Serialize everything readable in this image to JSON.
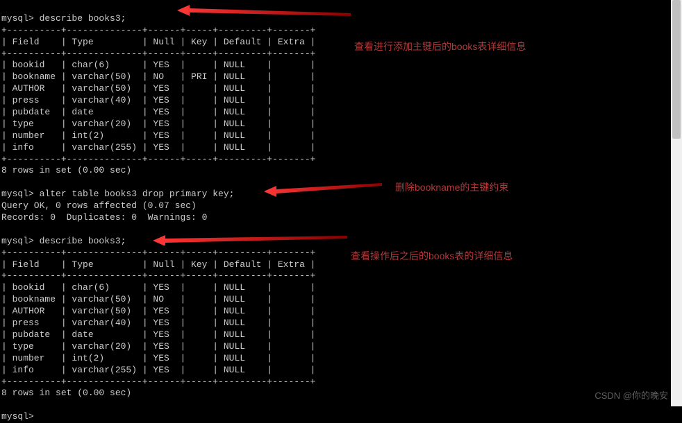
{
  "terminal": {
    "cmd1_prompt": "mysql>",
    "cmd1": " describe books3;",
    "border_top1": "+----------+--------------+------+-----+---------+-------+",
    "header1": "| Field    | Type         | Null | Key | Default | Extra |",
    "border_mid1": "+----------+--------------+------+-----+---------+-------+",
    "rows1": [
      "| bookid   | char(6)      | YES  |     | NULL    |       |",
      "| bookname | varchar(50)  | NO   | PRI | NULL    |       |",
      "| AUTHOR   | varchar(50)  | YES  |     | NULL    |       |",
      "| press    | varchar(40)  | YES  |     | NULL    |       |",
      "| pubdate  | date         | YES  |     | NULL    |       |",
      "| type     | varchar(20)  | YES  |     | NULL    |       |",
      "| number   | int(2)       | YES  |     | NULL    |       |",
      "| info     | varchar(255) | YES  |     | NULL    |       |"
    ],
    "border_bot1": "+----------+--------------+------+-----+---------+-------+",
    "result1": "8 rows in set (0.00 sec)",
    "cmd2_prompt": "mysql>",
    "cmd2": " alter table books3 drop primary key;",
    "result2a": "Query OK, 0 rows affected (0.07 sec)",
    "result2b": "Records: 0  Duplicates: 0  Warnings: 0",
    "cmd3_prompt": "mysql>",
    "cmd3": " describe books3;",
    "border_top2": "+----------+--------------+------+-----+---------+-------+",
    "header2": "| Field    | Type         | Null | Key | Default | Extra |",
    "border_mid2": "+----------+--------------+------+-----+---------+-------+",
    "rows2": [
      "| bookid   | char(6)      | YES  |     | NULL    |       |",
      "| bookname | varchar(50)  | NO   |     | NULL    |       |",
      "| AUTHOR   | varchar(50)  | YES  |     | NULL    |       |",
      "| press    | varchar(40)  | YES  |     | NULL    |       |",
      "| pubdate  | date         | YES  |     | NULL    |       |",
      "| type     | varchar(20)  | YES  |     | NULL    |       |",
      "| number   | int(2)       | YES  |     | NULL    |       |",
      "| info     | varchar(255) | YES  |     | NULL    |       |"
    ],
    "border_bot2": "+----------+--------------+------+-----+---------+-------+",
    "result3": "8 rows in set (0.00 sec)",
    "cmd4_prompt": "mysql>",
    "cmd4": " "
  },
  "annotations": {
    "note1": "查看进行添加主键后的books表详细信息",
    "note2": "删除bookname的主键约束",
    "note3": "查看操作后之后的books表的详细信息"
  },
  "watermark": "CSDN @你的晚安"
}
